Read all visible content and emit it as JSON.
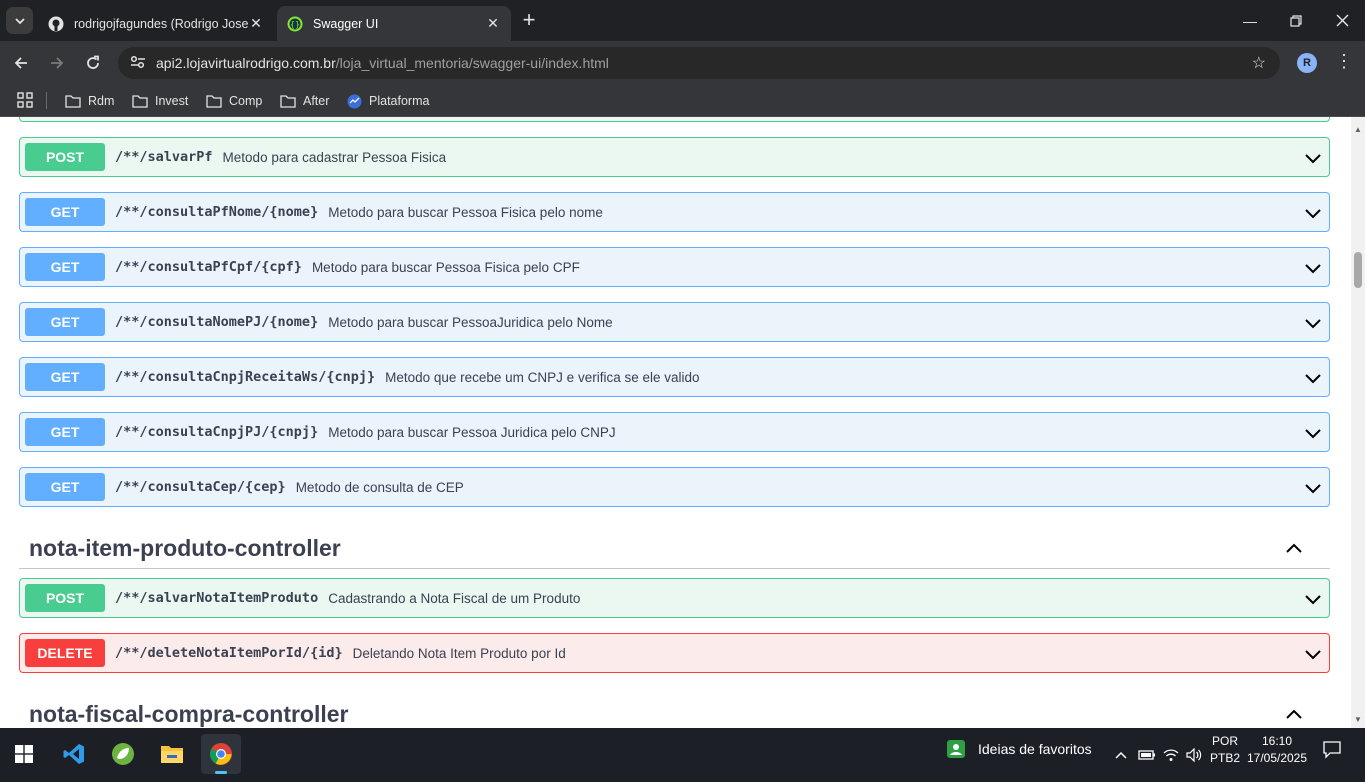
{
  "browser": {
    "tabs": [
      {
        "title": "rodrigojfagundes (Rodrigo Jose",
        "active": false,
        "icon": "github-icon"
      },
      {
        "title": "Swagger UI",
        "active": true,
        "icon": "swagger-icon"
      }
    ],
    "url_host": "api2.lojavirtualrodrigo.com.br",
    "url_path": "/loja_virtual_mentoria/swagger-ui/index.html",
    "profile_initial": "R",
    "bookmarks": [
      "Rdm",
      "Invest",
      "Comp",
      "After",
      "Plataforma"
    ]
  },
  "operations": [
    {
      "method": "POST",
      "path": "/**/salvarPf",
      "summary": "Metodo para cadastrar Pessoa Fisica"
    },
    {
      "method": "GET",
      "path": "/**/consultaPfNome/{nome}",
      "summary": "Metodo para buscar Pessoa Fisica pelo nome"
    },
    {
      "method": "GET",
      "path": "/**/consultaPfCpf/{cpf}",
      "summary": "Metodo para buscar Pessoa Fisica pelo CPF"
    },
    {
      "method": "GET",
      "path": "/**/consultaNomePJ/{nome}",
      "summary": "Metodo para buscar PessoaJuridica pelo Nome"
    },
    {
      "method": "GET",
      "path": "/**/consultaCnpjReceitaWs/{cnpj}",
      "summary": "Metodo que recebe um CNPJ e verifica se ele valido"
    },
    {
      "method": "GET",
      "path": "/**/consultaCnpjPJ/{cnpj}",
      "summary": "Metodo para buscar Pessoa Juridica pelo CNPJ"
    },
    {
      "method": "GET",
      "path": "/**/consultaCep/{cep}",
      "summary": "Metodo de consulta de CEP"
    }
  ],
  "tag_sections": [
    {
      "name": "nota-item-produto-controller",
      "operations": [
        {
          "method": "POST",
          "path": "/**/salvarNotaItemProduto",
          "summary": "Cadastrando a Nota Fiscal de um Produto"
        },
        {
          "method": "DELETE",
          "path": "/**/deleteNotaItemPorId/{id}",
          "summary": "Deletando Nota Item Produto por Id"
        }
      ]
    },
    {
      "name": "nota-fiscal-compra-controller",
      "operations": []
    }
  ],
  "taskbar": {
    "widget_label": "Ideias de favoritos",
    "language": "POR",
    "layout": "PTB2",
    "time": "16:10",
    "date": "17/05/2025"
  },
  "colors": {
    "post": "#49cc90",
    "get": "#61affe",
    "delete": "#f93e3e",
    "text": "#3b4151"
  }
}
